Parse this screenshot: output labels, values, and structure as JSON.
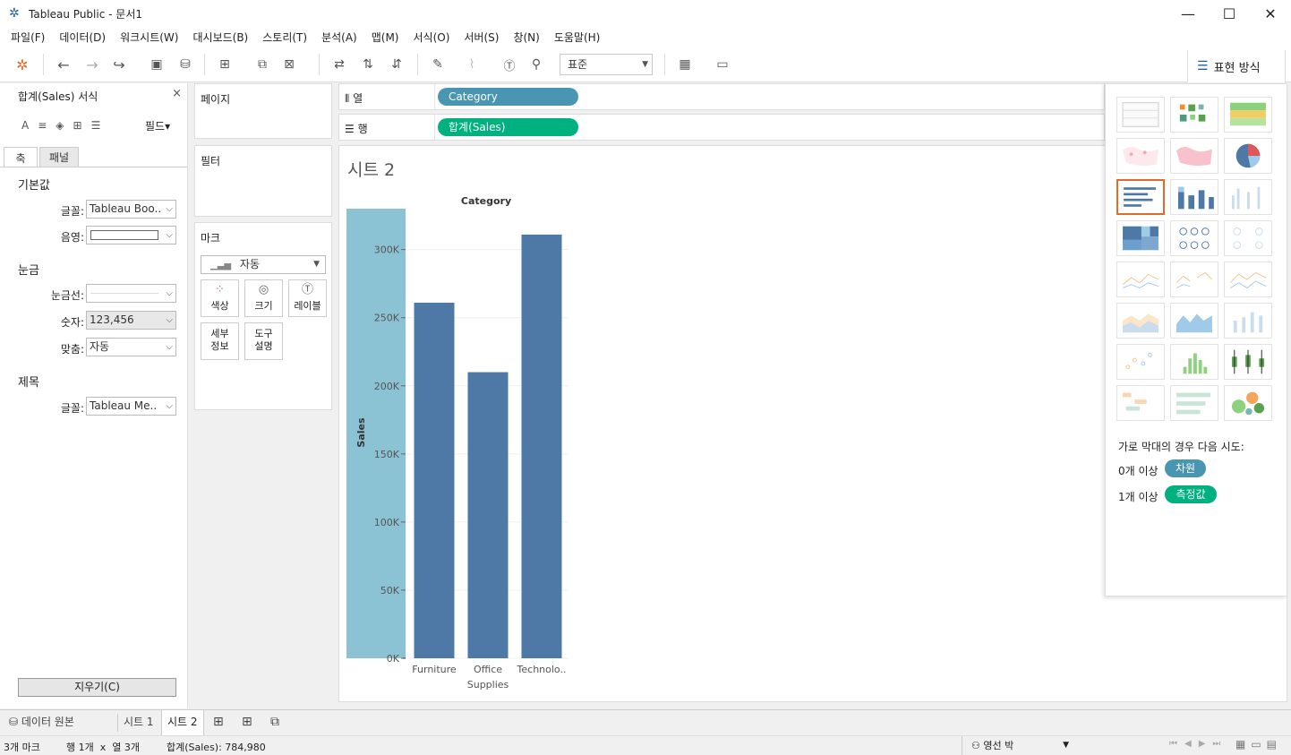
{
  "window": {
    "title": "Tableau Public - 문서1",
    "minimize": "—",
    "maximize": "☐",
    "close": "✕"
  },
  "menu": [
    "파일(F)",
    "데이터(D)",
    "워크시트(W)",
    "대시보드(B)",
    "스토리(T)",
    "분석(A)",
    "맵(M)",
    "서식(O)",
    "서버(S)",
    "창(N)",
    "도움말(H)"
  ],
  "toolbar": {
    "fit_select": "표준",
    "show_me_label": "표현 방식"
  },
  "format_panel": {
    "title": "합계(Sales) 서식",
    "close": "×",
    "field_button": "필드▾",
    "tabs": [
      "축",
      "패널"
    ],
    "default_section": "기본값",
    "font_label": "글꼴:",
    "font_value": "Tableau Boo..",
    "shading_label": "음영:",
    "ticks_section": "눈금",
    "tick_line_label": "눈금선:",
    "numbers_label": "숫자:",
    "numbers_value": "123,456",
    "alignment_label": "맞춤:",
    "alignment_value": "자동",
    "title_section": "제목",
    "title_font_label": "글꼴:",
    "title_font_value": "Tableau Me..",
    "clear_button": "지우기(C)"
  },
  "cards": {
    "pages_title": "페이지",
    "filters_title": "필터",
    "marks_title": "마크",
    "mark_type": "자동",
    "color": "색상",
    "size": "크기",
    "label": "레이블",
    "detail": [
      "세부",
      "정보"
    ],
    "tooltip": [
      "도구",
      "설명"
    ]
  },
  "shelves": {
    "columns_label": "열",
    "rows_label": "행",
    "columns_pill": "Category",
    "rows_pill": "합계(Sales)"
  },
  "sheet": {
    "title": "시트 2"
  },
  "chart_data": {
    "type": "bar",
    "title": "Category",
    "categories": [
      "Furniture",
      "Office Supplies",
      "Technology"
    ],
    "category_labels": [
      "Furniture",
      "Office",
      "Technolo.."
    ],
    "category_labels_line2": [
      "",
      "Supplies",
      ""
    ],
    "values": [
      261000,
      210000,
      311000
    ],
    "ylabel": "Sales",
    "ylim": [
      0,
      330000
    ],
    "yticks": [
      0,
      50000,
      100000,
      150000,
      200000,
      250000,
      300000
    ],
    "ytick_labels": [
      "0K",
      "50K",
      "100K",
      "150K",
      "200K",
      "250K",
      "300K"
    ],
    "bar_color": "#4e79a7",
    "axis_highlight_color": "#8bc2d4",
    "grid": true
  },
  "show_me": {
    "hint": "가로 막대의 경우 다음 시도:",
    "dim_text": "0개 이상",
    "dim_pill": "차원",
    "measure_text": "1개 이상",
    "measure_pill": "측정값",
    "dim_color": "#4996b2",
    "measure_color": "#00b180"
  },
  "sheet_tabs": {
    "data_source": "데이터 원본",
    "tabs": [
      "시트 1",
      "시트 2"
    ]
  },
  "status": {
    "marks": "3개 마크",
    "rows_cols": "행 1개  x  열 3개",
    "sum": "합계(Sales): 784,980",
    "user": "영선 박"
  }
}
